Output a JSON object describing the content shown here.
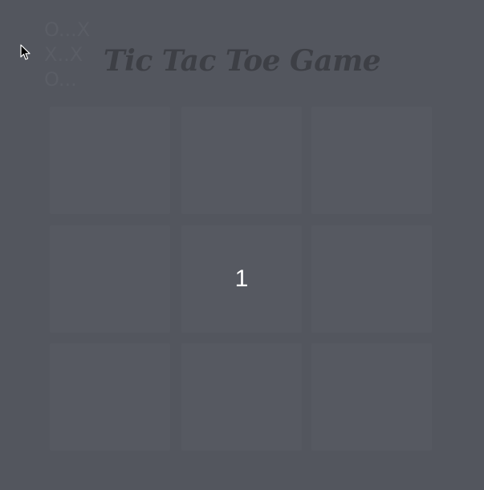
{
  "title": "Tic Tac Toe Game",
  "scoreboard": {
    "line1": "O...X",
    "line2": "X..X",
    "line3": "O..."
  },
  "board": {
    "cells": [
      "",
      "",
      "",
      "",
      "1",
      "",
      "",
      "",
      ""
    ]
  },
  "colors": {
    "background": "#53565e",
    "cell": "#565961",
    "title": "#3d3f45",
    "cell_text": "#ffffff"
  },
  "icons": {
    "cursor": "arrow-cursor-icon"
  }
}
